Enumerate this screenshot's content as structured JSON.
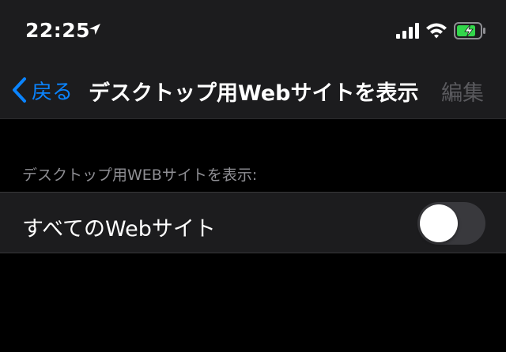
{
  "status_bar": {
    "time": "22:25",
    "location_icon": "location-arrow-icon",
    "signal_icon": "cellular-signal-icon",
    "wifi_icon": "wifi-icon",
    "battery_icon": "battery-charging-icon",
    "battery_color": "#32d74b"
  },
  "nav": {
    "back_label": "戻る",
    "title": "デスクトップ用Webサイトを表示",
    "edit_label": "編集",
    "accent_color": "#0a84ff"
  },
  "section": {
    "header": "デスクトップ用WEBサイトを表示:"
  },
  "setting": {
    "label": "すべてのWebサイト",
    "toggle_state": "off"
  }
}
